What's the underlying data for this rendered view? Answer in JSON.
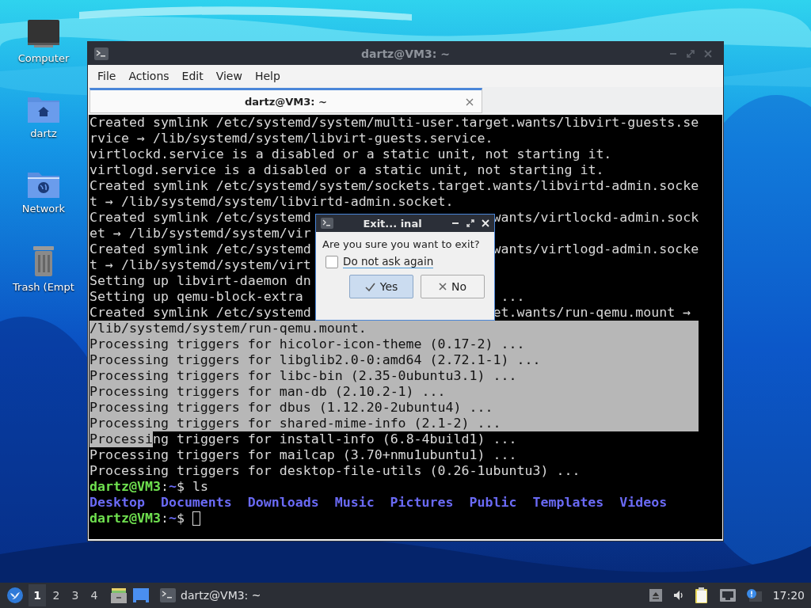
{
  "desktop": {
    "icons": [
      {
        "label": "Computer",
        "kind": "computer"
      },
      {
        "label": "dartz",
        "kind": "home"
      },
      {
        "label": "Network",
        "kind": "network"
      },
      {
        "label": "Trash (Empt",
        "kind": "trash"
      }
    ]
  },
  "window": {
    "title": "dartz@VM3: ~",
    "menu": [
      "File",
      "Actions",
      "Edit",
      "View",
      "Help"
    ],
    "tabs": [
      {
        "label": "dartz@VM3: ~",
        "selected": true
      }
    ]
  },
  "terminal": {
    "lines": [
      {
        "kind": "output",
        "selected": false,
        "parts": [
          {
            "text": "Created symlink /etc/systemd/system/multi-user.target.wants/libvirt-guests.se",
            "selected": false
          }
        ]
      },
      {
        "kind": "output",
        "selected": false,
        "parts": [
          {
            "text": "rvice → /lib/systemd/system/libvirt-guests.service.",
            "selected": false
          }
        ]
      },
      {
        "kind": "output",
        "selected": false,
        "parts": [
          {
            "text": "virtlockd.service is a disabled or a static unit, not starting it.",
            "selected": false
          }
        ]
      },
      {
        "kind": "output",
        "selected": false,
        "parts": [
          {
            "text": "virtlogd.service is a disabled or a static unit, not starting it.",
            "selected": false
          }
        ]
      },
      {
        "kind": "output",
        "selected": false,
        "parts": [
          {
            "text": "Created symlink /etc/systemd/system/sockets.target.wants/libvirtd-admin.socke",
            "selected": false
          }
        ]
      },
      {
        "kind": "output",
        "selected": false,
        "parts": [
          {
            "text": "t → /lib/systemd/system/libvirtd-admin.socket.",
            "selected": false
          }
        ]
      },
      {
        "kind": "output",
        "selected": false,
        "parts": [
          {
            "text": "Created symlink /etc/systemd",
            "selected": false
          }
        ],
        "right": "wants/virtlockd-admin.sock"
      },
      {
        "kind": "output",
        "selected": false,
        "parts": [
          {
            "text": "et → /lib/systemd/system/vir",
            "selected": false
          }
        ]
      },
      {
        "kind": "output",
        "selected": false,
        "parts": [
          {
            "text": "Created symlink /etc/systemd",
            "selected": false
          }
        ],
        "right": "wants/virtlogd-admin.socke"
      },
      {
        "kind": "output",
        "selected": false,
        "parts": [
          {
            "text": "t → /lib/systemd/system/virt",
            "selected": false
          }
        ]
      },
      {
        "kind": "output",
        "selected": false,
        "parts": [
          {
            "text": "Setting up libvirt-daemon dn",
            "selected": false
          }
        ]
      },
      {
        "kind": "output",
        "selected": false,
        "parts": [
          {
            "text": "Setting up qemu-block-extra",
            "selected": false
          }
        ],
        "right": " ..."
      },
      {
        "kind": "output",
        "selected": false,
        "parts": [
          {
            "text": "Created symlink /etc/systemd",
            "selected": false
          }
        ],
        "right": "et.wants/run-qemu.mount →"
      },
      {
        "kind": "output",
        "selected": true,
        "parts": [
          {
            "text": "/lib/systemd/system/run-qemu.mount.",
            "selected": false
          }
        ]
      },
      {
        "kind": "output",
        "selected": true,
        "parts": [
          {
            "text": "Processing triggers for hicolor-icon-theme (0.17-2) ...",
            "selected": false
          }
        ]
      },
      {
        "kind": "output",
        "selected": true,
        "parts": [
          {
            "text": "Processing triggers for libglib2.0-0:amd64 (2.72.1-1) ...",
            "selected": false
          }
        ]
      },
      {
        "kind": "output",
        "selected": true,
        "parts": [
          {
            "text": "Processing triggers for libc-bin (2.35-0ubuntu3.1) ...",
            "selected": false
          }
        ]
      },
      {
        "kind": "output",
        "selected": true,
        "parts": [
          {
            "text": "Processing triggers for man-db (2.10.2-1) ...",
            "selected": false
          }
        ]
      },
      {
        "kind": "output",
        "selected": true,
        "parts": [
          {
            "text": "Processing triggers for dbus (1.12.20-2ubuntu4) ...",
            "selected": false
          }
        ]
      },
      {
        "kind": "output",
        "selected": true,
        "parts": [
          {
            "text": "Processing triggers for shared-mime-info (2.1-2) ...",
            "selected": false
          }
        ]
      },
      {
        "kind": "output",
        "selected": false,
        "parts": [
          {
            "text": "Processi",
            "selected": true
          },
          {
            "text": "ng triggers for install-info (6.8-4build1) ...",
            "selected": false
          }
        ]
      },
      {
        "kind": "output",
        "selected": false,
        "parts": [
          {
            "text": "Processing triggers for mailcap (3.70+nmu1ubuntu1) ...",
            "selected": false
          }
        ]
      },
      {
        "kind": "output",
        "selected": false,
        "parts": [
          {
            "text": "Processing triggers for desktop-file-utils (0.26-1ubuntu3) ...",
            "selected": false
          }
        ]
      },
      {
        "kind": "prompt",
        "user": "dartz@VM3",
        "separator": ":",
        "path": "~",
        "symbol": "$",
        "command": "ls",
        "cursor": false
      },
      {
        "kind": "listing",
        "items": [
          "Desktop",
          "Documents",
          "Downloads",
          "Music",
          "Pictures",
          "Public",
          "Templates",
          "Videos"
        ]
      },
      {
        "kind": "prompt",
        "user": "dartz@VM3",
        "separator": ":",
        "path": "~",
        "symbol": "$",
        "cursor": true
      }
    ]
  },
  "dialog": {
    "title": "Exit... inal",
    "message": "Are you sure you want to exit?",
    "checkbox": {
      "label": "Do not ask again",
      "checked": false
    },
    "buttons": [
      {
        "label": "Yes",
        "kind": "yes",
        "selected": true
      },
      {
        "label": "No",
        "kind": "no",
        "selected": false
      }
    ]
  },
  "taskbar": {
    "workspaces": [
      {
        "label": "1",
        "selected": true
      },
      {
        "label": "2",
        "selected": false
      },
      {
        "label": "3",
        "selected": false
      },
      {
        "label": "4",
        "selected": false
      }
    ],
    "tasks": [
      {
        "label": "dartz@VM3: ~"
      }
    ],
    "clock": "17:20"
  }
}
